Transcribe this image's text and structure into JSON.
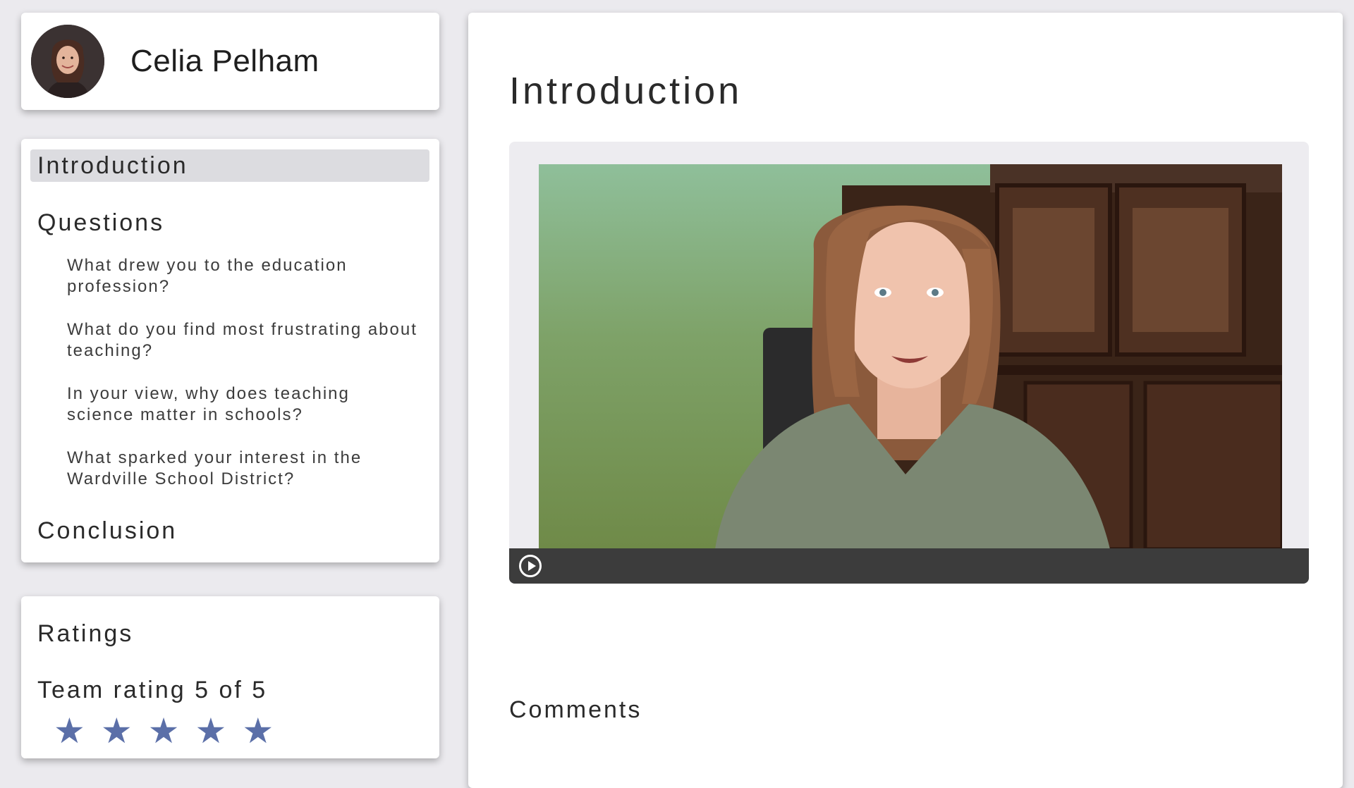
{
  "profile": {
    "name": "Celia Pelham"
  },
  "nav": {
    "introduction": "Introduction",
    "questions": "Questions",
    "question_items": [
      "What drew you to the education profession?",
      "What do you find most frustrating about teaching?",
      "In your view, why does teaching science matter in schools?",
      "What sparked your interest in the Wardville School District?"
    ],
    "conclusion": "Conclusion",
    "active": "Introduction"
  },
  "ratings": {
    "title": "Ratings",
    "team_rating_label": "Team rating 5 of 5",
    "stars": 5
  },
  "main": {
    "title": "Introduction",
    "comments_title": "Comments"
  },
  "colors": {
    "background": "#ebeaee",
    "active_nav": "#dcdce0",
    "star": "#5b6fa8",
    "video_controls": "#3c3c3c"
  },
  "icons": {
    "play": "play-icon",
    "star": "star-icon"
  }
}
